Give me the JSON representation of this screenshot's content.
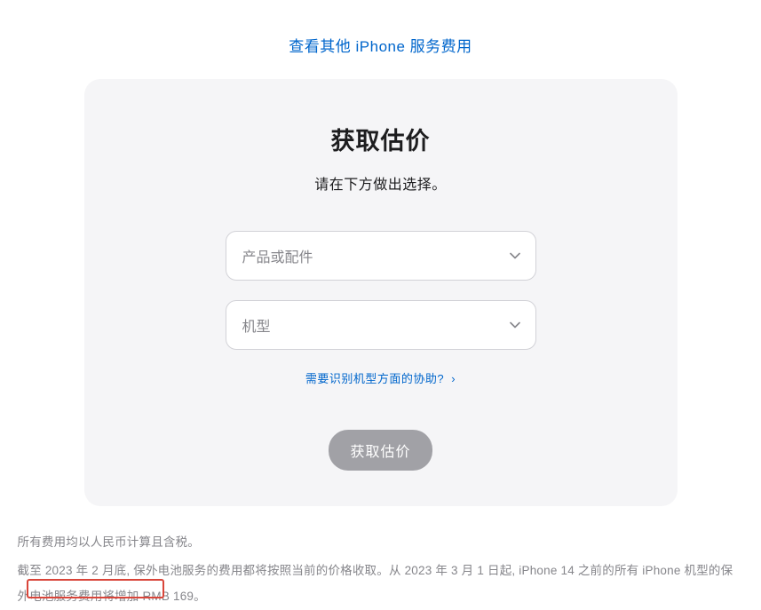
{
  "topLink": {
    "label": "查看其他 iPhone 服务费用"
  },
  "card": {
    "title": "获取估价",
    "subtitle": "请在下方做出选择。",
    "select1": {
      "placeholder": "产品或配件"
    },
    "select2": {
      "placeholder": "机型"
    },
    "helpLink": {
      "label": "需要识别机型方面的协助?",
      "arrow": "›"
    },
    "button": {
      "label": "获取估价"
    }
  },
  "footer": {
    "line1": "所有费用均以人民币计算且含税。",
    "line2": "截至 2023 年 2 月底, 保外电池服务的费用都将按照当前的价格收取。从 2023 年 3 月 1 日起, iPhone 14 之前的所有 iPhone 机型的保外电池服务费用将增加 RMB 169。"
  }
}
